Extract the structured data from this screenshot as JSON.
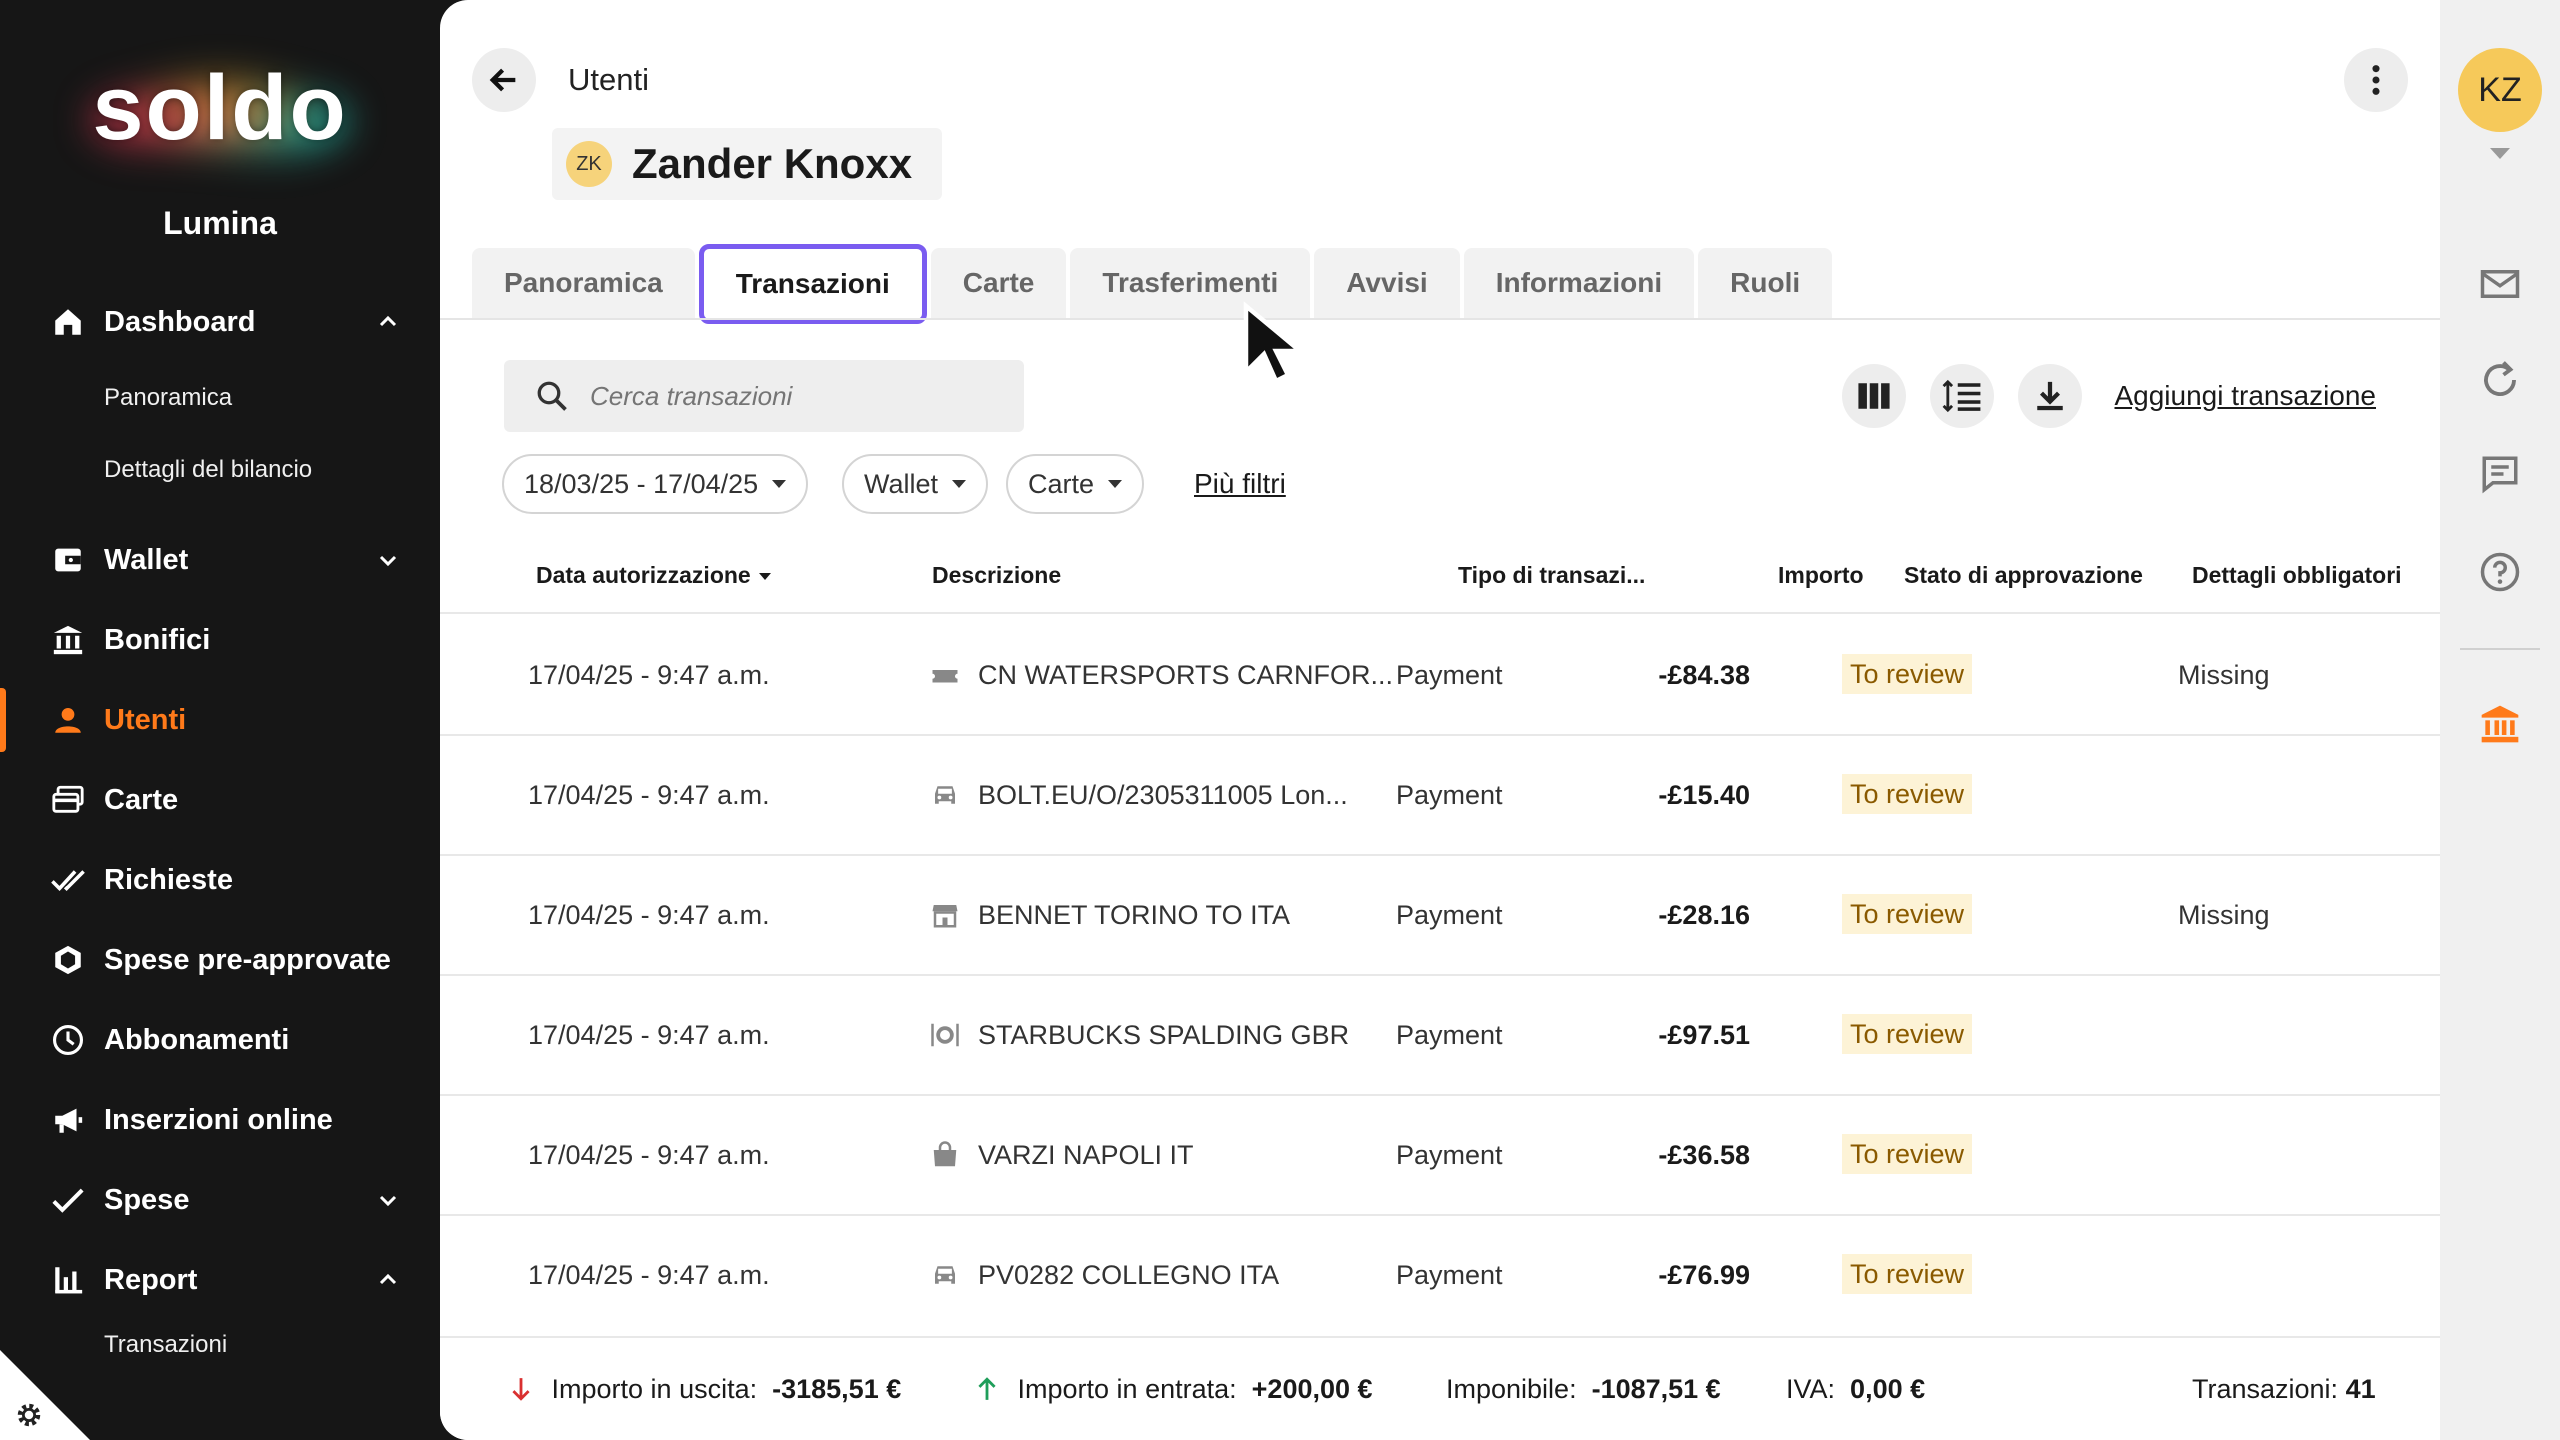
{
  "brand": {
    "logo": "soldo",
    "company": "Lumina"
  },
  "sidebar": {
    "items": [
      {
        "label": "Dashboard",
        "icon": "home-icon",
        "expanded": true
      },
      {
        "label": "Panoramica"
      },
      {
        "label": "Dettagli del bilancio"
      },
      {
        "label": "Wallet",
        "icon": "wallet-icon",
        "expanded": false
      },
      {
        "label": "Bonifici",
        "icon": "bank-transfer-icon"
      },
      {
        "label": "Utenti",
        "icon": "user-icon",
        "active": true
      },
      {
        "label": "Carte",
        "icon": "cards-icon"
      },
      {
        "label": "Richieste",
        "icon": "double-check-icon"
      },
      {
        "label": "Spese pre-approvate",
        "icon": "hexagon-icon"
      },
      {
        "label": "Abbonamenti",
        "icon": "clock-icon"
      },
      {
        "label": "Inserzioni online",
        "icon": "megaphone-icon"
      },
      {
        "label": "Spese",
        "icon": "check-icon",
        "expanded": false
      },
      {
        "label": "Report",
        "icon": "bar-chart-icon",
        "expanded": true
      },
      {
        "label": "Transazioni"
      }
    ]
  },
  "header": {
    "breadcrumb": "Utenti",
    "user": {
      "initials": "ZK",
      "name": "Zander Knoxx"
    }
  },
  "tabs": [
    "Panoramica",
    "Transazioni",
    "Carte",
    "Trasferimenti",
    "Avvisi",
    "Informazioni",
    "Ruoli"
  ],
  "active_tab": "Transazioni",
  "toolbar": {
    "search_placeholder": "Cerca transazioni",
    "add_label": "Aggiungi transazione"
  },
  "filters": {
    "date": "18/03/25 - 17/04/25",
    "wallet": "Wallet",
    "cards": "Carte",
    "more": "Più filtri"
  },
  "table": {
    "headers": [
      "Data autorizzazione",
      "Descrizione",
      "Tipo di transazi...",
      "Importo",
      "Stato di approvazione",
      "Dettagli obbligatori"
    ],
    "rows": [
      {
        "date": "17/04/25 - 9:47 a.m.",
        "icon": "ticket-icon",
        "desc": "CN WATERSPORTS CARNFOR...",
        "type": "Payment",
        "amount": "-£84.38",
        "status": "To review",
        "details": "Missing"
      },
      {
        "date": "17/04/25 - 9:47 a.m.",
        "icon": "car-icon",
        "desc": "BOLT.EU/O/2305311005 Lon...",
        "type": "Payment",
        "amount": "-£15.40",
        "status": "To review",
        "details": ""
      },
      {
        "date": "17/04/25 - 9:47 a.m.",
        "icon": "store-icon",
        "desc": "BENNET TORINO TO ITA",
        "type": "Payment",
        "amount": "-£28.16",
        "status": "To review",
        "details": "Missing"
      },
      {
        "date": "17/04/25 - 9:47 a.m.",
        "icon": "restaurant-icon",
        "desc": "STARBUCKS SPALDING GBR",
        "type": "Payment",
        "amount": "-£97.51",
        "status": "To review",
        "details": ""
      },
      {
        "date": "17/04/25 - 9:47 a.m.",
        "icon": "shopping-bag-icon",
        "desc": "VARZI NAPOLI IT",
        "type": "Payment",
        "amount": "-£36.58",
        "status": "To review",
        "details": ""
      },
      {
        "date": "17/04/25 - 9:47 a.m.",
        "icon": "car-icon",
        "desc": "PV0282 COLLEGNO ITA",
        "type": "Payment",
        "amount": "-£76.99",
        "status": "To review",
        "details": ""
      }
    ]
  },
  "footer": {
    "out_label": "Importo in uscita:",
    "out_value": "-3185,51 €",
    "in_label": "Importo in entrata:",
    "in_value": "+200,00 €",
    "taxable_label": "Imponibile:",
    "taxable_value": "-1087,51 €",
    "vat_label": "IVA:",
    "vat_value": "0,00 €",
    "count_label": "Transazioni:",
    "count_value": "41"
  },
  "rail": {
    "avatar_initials": "KZ"
  },
  "colors": {
    "accent": "#ff7a1a",
    "tab_focus": "#7a5cf0",
    "badge_bg": "#fdf3d6",
    "sidebar_bg": "#161616"
  }
}
